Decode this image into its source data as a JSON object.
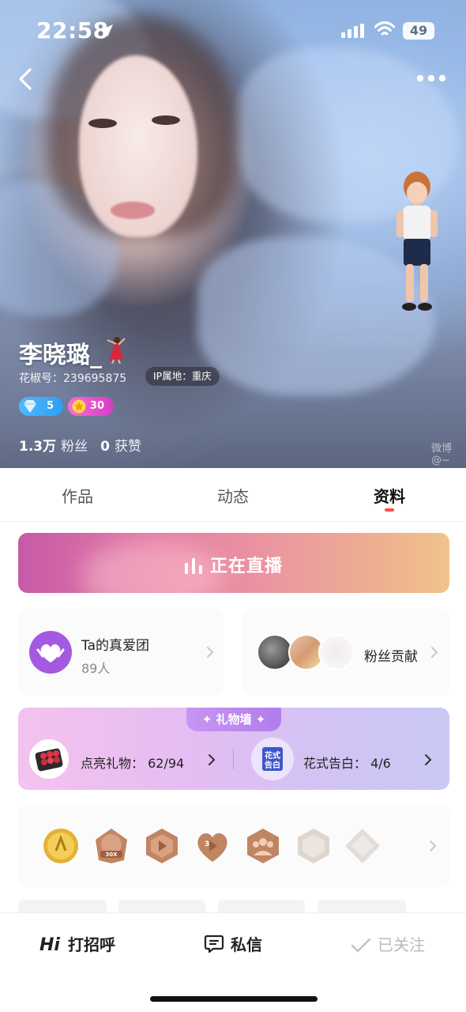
{
  "status_bar": {
    "time": "22:58",
    "battery": "49"
  },
  "profile": {
    "name": "李晓璐_",
    "id_label": "花椒号：239695875",
    "ip_location": "IP属地：重庆",
    "badges": {
      "diamond_level": "5",
      "star_level": "30"
    },
    "stats": {
      "fans_value": "1.3万",
      "fans_label": "粉丝",
      "likes_value": "0",
      "likes_label": "获赞"
    },
    "watermark": "微博@~"
  },
  "tabs": [
    {
      "label": "作品",
      "active": false
    },
    {
      "label": "动态",
      "active": false
    },
    {
      "label": "资料",
      "active": true
    }
  ],
  "live_banner": {
    "label": "正在直播"
  },
  "fan_club": {
    "title": "Ta的真爱团",
    "count": "89人"
  },
  "fan_contribution": {
    "title": "粉丝贡献"
  },
  "gift_wall": {
    "title": "礼物墙",
    "lit_gifts": "点亮礼物：  62/94",
    "confession_icon_text": "花式告白",
    "confession": "花式告白：  4/6"
  },
  "medals": {
    "items": [
      {
        "icon": "gold-medal-icon",
        "color": "#d9a728"
      },
      {
        "icon": "bronze-30x-medal-icon",
        "color": "#c08563",
        "text": "30X"
      },
      {
        "icon": "bronze-play-hexagon-icon",
        "color": "#c08563"
      },
      {
        "icon": "bronze-heart-3-icon",
        "color": "#c08563",
        "text": "3"
      },
      {
        "icon": "bronze-group-hexagon-icon",
        "color": "#c08563"
      },
      {
        "icon": "silver-hexagon-icon",
        "color": "#d8d2cc"
      },
      {
        "icon": "silver-diamond-icon",
        "color": "#e3ddd8"
      }
    ]
  },
  "bottom_bar": {
    "hi_text": "Hi",
    "greet": "打招呼",
    "message": "私信",
    "followed": "已关注"
  },
  "colors": {
    "tab_indicator": "#ff4d4f",
    "fanclub_purple": "#a45ae0"
  }
}
